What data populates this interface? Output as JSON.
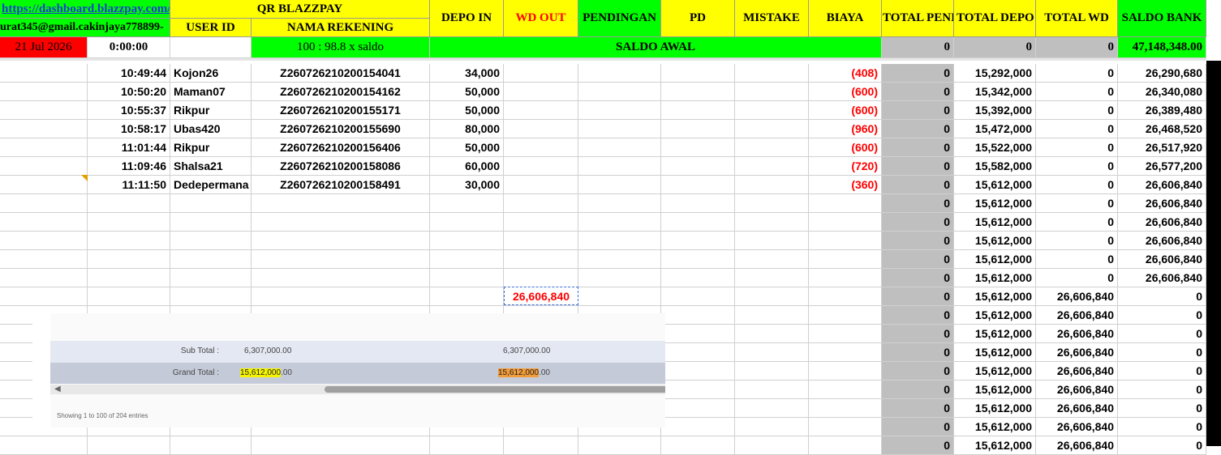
{
  "header": {
    "url": "https://dashboard.blazzpay.com/",
    "email": "urat345@gmail.cakinjaya778899-",
    "date": "21 Jul 2026",
    "time_start": "0:00:00",
    "qr_title": "QR BLAZZPAY",
    "col_user_id": "USER ID",
    "col_nama_rekening": "NAMA REKENING",
    "col_depo_in": "DEPO IN",
    "col_wd_out": "WD OUT",
    "col_pendingan": "PENDINGAN",
    "col_pd": "PD",
    "col_mistake": "MISTAKE",
    "col_biaya": "BIAYA",
    "col_total_pend": "TOTAL PENI",
    "col_total_depo": "TOTAL DEPO",
    "col_total_wd": "TOTAL WD",
    "col_saldo_bank": "SALDO BANK",
    "rate_text": "100 : 98.8 x saldo",
    "saldo_awal": "SALDO AWAL",
    "init_total_pend": "0",
    "init_total_depo": "0",
    "init_total_wd": "0",
    "init_saldo_bank": "47,148,348.00"
  },
  "transactions": [
    {
      "time": "10:49:44",
      "user": "Kojon26",
      "rek": "Z260726210200154041",
      "depo": "34,000",
      "biaya": "(408)",
      "tp": "0",
      "td": "15,292,000",
      "tw": "0",
      "sb": "26,290,680"
    },
    {
      "time": "10:50:20",
      "user": "Maman07",
      "rek": "Z260726210200154162",
      "depo": "50,000",
      "biaya": "(600)",
      "tp": "0",
      "td": "15,342,000",
      "tw": "0",
      "sb": "26,340,080"
    },
    {
      "time": "10:55:37",
      "user": "Rikpur",
      "rek": "Z260726210200155171",
      "depo": "50,000",
      "biaya": "(600)",
      "tp": "0",
      "td": "15,392,000",
      "tw": "0",
      "sb": "26,389,480"
    },
    {
      "time": "10:58:17",
      "user": "Ubas420",
      "rek": "Z260726210200155690",
      "depo": "80,000",
      "biaya": "(960)",
      "tp": "0",
      "td": "15,472,000",
      "tw": "0",
      "sb": "26,468,520"
    },
    {
      "time": "11:01:44",
      "user": "Rikpur",
      "rek": "Z260726210200156406",
      "depo": "50,000",
      "biaya": "(600)",
      "tp": "0",
      "td": "15,522,000",
      "tw": "0",
      "sb": "26,517,920"
    },
    {
      "time": "11:09:46",
      "user": "Shalsa21",
      "rek": "Z260726210200158086",
      "depo": "60,000",
      "biaya": "(720)",
      "tp": "0",
      "td": "15,582,000",
      "tw": "0",
      "sb": "26,577,200"
    },
    {
      "time": "11:11:50",
      "user": "Dedepermana",
      "rek": "Z260726210200158491",
      "depo": "30,000",
      "biaya": "(360)",
      "tp": "0",
      "td": "15,612,000",
      "tw": "0",
      "sb": "26,606,840"
    }
  ],
  "totals_rows": [
    {
      "tp": "0",
      "td": "15,612,000",
      "tw": "0",
      "sb": "26,606,840"
    },
    {
      "tp": "0",
      "td": "15,612,000",
      "tw": "0",
      "sb": "26,606,840"
    },
    {
      "tp": "0",
      "td": "15,612,000",
      "tw": "0",
      "sb": "26,606,840"
    },
    {
      "tp": "0",
      "td": "15,612,000",
      "tw": "0",
      "sb": "26,606,840"
    },
    {
      "tp": "0",
      "td": "15,612,000",
      "tw": "0",
      "sb": "26,606,840"
    },
    {
      "tp": "0",
      "td": "15,612,000",
      "tw": "26,606,840",
      "sb": "0"
    },
    {
      "tp": "0",
      "td": "15,612,000",
      "tw": "26,606,840",
      "sb": "0"
    },
    {
      "tp": "0",
      "td": "15,612,000",
      "tw": "26,606,840",
      "sb": "0"
    },
    {
      "tp": "0",
      "td": "15,612,000",
      "tw": "26,606,840",
      "sb": "0"
    },
    {
      "tp": "0",
      "td": "15,612,000",
      "tw": "26,606,840",
      "sb": "0"
    },
    {
      "tp": "0",
      "td": "15,612,000",
      "tw": "26,606,840",
      "sb": "0"
    },
    {
      "tp": "0",
      "td": "15,612,000",
      "tw": "26,606,840",
      "sb": "0"
    },
    {
      "tp": "0",
      "td": "15,612,000",
      "tw": "26,606,840",
      "sb": "0"
    },
    {
      "tp": "0",
      "td": "15,612,000",
      "tw": "26,606,840",
      "sb": "0"
    }
  ],
  "selected_cell_value": "26,606,840",
  "overlay": {
    "sub_total_label": "Sub Total :",
    "sub_total_value_1": "6,307,000.00",
    "sub_total_value_2": "6,307,000.00",
    "grand_total_label": "Grand Total :",
    "grand_total_value_1_hl": "15,612,000",
    "grand_total_value_1_rest": ".00",
    "grand_total_value_2_hl": "15,612,000",
    "grand_total_value_2_rest": ".00",
    "footer": "Showing 1 to 100 of 204 entries",
    "scroll_left_icon": "arrow-left-icon"
  },
  "colors": {
    "yellow": "#ffff00",
    "green": "#00ff00",
    "red": "#ff0000",
    "gray": "#bfbfbf",
    "selection": "#3b6fd6"
  }
}
